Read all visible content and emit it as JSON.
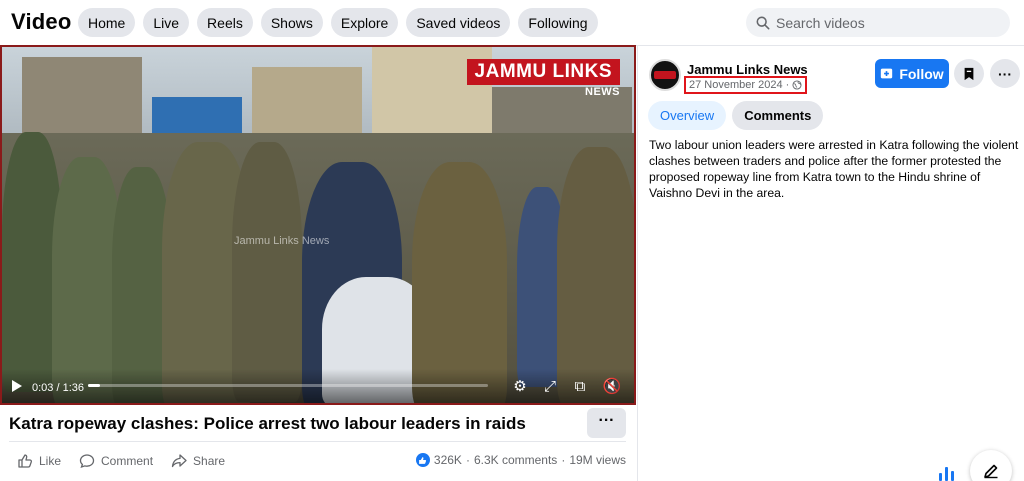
{
  "header": {
    "title": "Video",
    "nav": [
      "Home",
      "Live",
      "Reels",
      "Shows",
      "Explore",
      "Saved videos",
      "Following"
    ],
    "search_placeholder": "Search videos"
  },
  "video": {
    "brand_top": "JAMMU LINKS",
    "brand_bottom": "NEWS",
    "watermark": "Jammu Links News",
    "time": "0:03 / 1:36",
    "progress": 0.031,
    "title": "Katra ropeway clashes: Police arrest two labour leaders in raids"
  },
  "actions": {
    "like": "Like",
    "comment": "Comment",
    "share": "Share",
    "reactions": "326K",
    "comments": "6.3K comments",
    "views": "19M views"
  },
  "panel": {
    "page_name": "Jammu Links News",
    "date": "27 November 2024 ·",
    "follow": "Follow",
    "tabs": [
      "Overview",
      "Comments"
    ],
    "description": "Two labour union leaders were arrested in Katra following the violent clashes between traders and police after the former protested the proposed ropeway line from Katra town to the Hindu shrine of Vaishno Devi in the area."
  },
  "colors": {
    "accent": "#1877f2",
    "highlight_border": "#e0151b",
    "brand_red": "#c3141e"
  }
}
